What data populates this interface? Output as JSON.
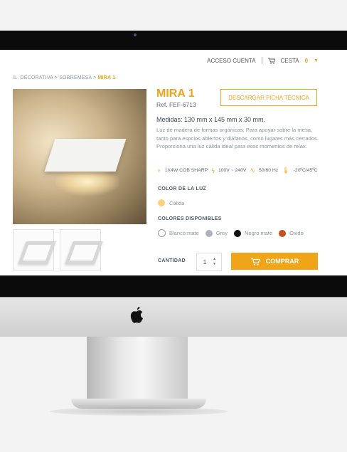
{
  "header": {
    "account_label": "ACCESO CUENTA",
    "cart_label": "CESTA",
    "cart_count": "0"
  },
  "breadcrumb": {
    "part1": "IL. DECORATIVA",
    "sep": " > ",
    "part2": "SOBREMESA",
    "current": "MIRA 1"
  },
  "product": {
    "title": "MIRA 1",
    "ref": "Ref. FEF-6713",
    "download_label": "DESCARGAR FICHA TÉCNICA",
    "measures": "Medidas: 130 mm x 145 mm x 30 mm.",
    "description": "Luz de madera de formas orgánicas. Para apoyar sobre la mesa, tanto para espcios abiertos y diáfanos, como lugares más cerrados. Proporciona una luz cálida ideal para esos momentos de relax.",
    "specs": [
      "1X4W COB SHARP",
      "100V ~ 240V",
      "50/60 Hz",
      "-20ºC/45ºC"
    ]
  },
  "light": {
    "label": "COLOR DE LA LUZ",
    "option": "Cálida",
    "color": "#f9d27a"
  },
  "colors": {
    "label": "COLORES DISPONIBLES",
    "options": [
      {
        "name": "Blanco mate",
        "color": "#ffffff"
      },
      {
        "name": "Grey",
        "color": "#a9b4bd"
      },
      {
        "name": "Negro mate",
        "color": "#111111"
      },
      {
        "name": "Oxido",
        "color": "#c8501e"
      }
    ]
  },
  "purchase": {
    "quantity_label": "CANTIDAD",
    "quantity": "1",
    "buy_label": "COMPRAR"
  },
  "accent_color": "#f0a418"
}
